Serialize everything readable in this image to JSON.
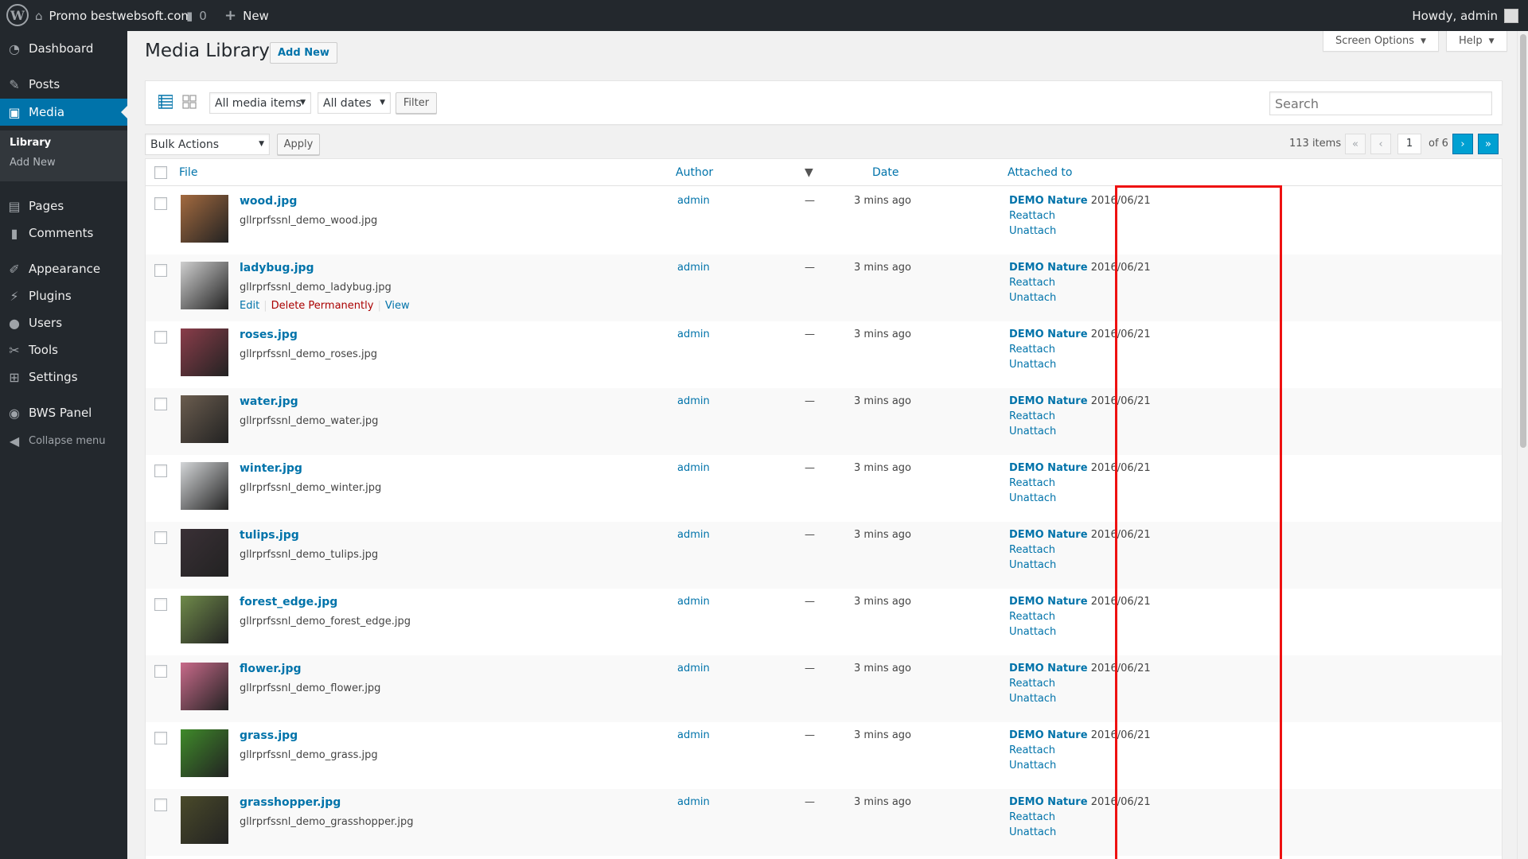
{
  "adminbar": {
    "site_name": "Promo bestwebsoft.com",
    "comments_count": "0",
    "new_label": "New",
    "howdy": "Howdy, admin"
  },
  "sidebar": {
    "items": [
      {
        "label": "Dashboard",
        "icon": "dashboard-icon"
      },
      {
        "label": "Posts",
        "icon": "pin-icon"
      },
      {
        "label": "Media",
        "icon": "media-icon"
      },
      {
        "label": "Pages",
        "icon": "pages-icon"
      },
      {
        "label": "Comments",
        "icon": "comments-icon"
      },
      {
        "label": "Appearance",
        "icon": "brush-icon"
      },
      {
        "label": "Plugins",
        "icon": "plugin-icon"
      },
      {
        "label": "Users",
        "icon": "users-icon"
      },
      {
        "label": "Tools",
        "icon": "wrench-icon"
      },
      {
        "label": "Settings",
        "icon": "settings-icon"
      },
      {
        "label": "BWS Panel",
        "icon": "bws-icon"
      }
    ],
    "submenu": [
      "Library",
      "Add New"
    ],
    "collapse": "Collapse menu"
  },
  "header": {
    "title": "Media Library",
    "add_new": "Add New",
    "screen_options": "Screen Options",
    "help": "Help"
  },
  "filters": {
    "media_type": "All media items",
    "dates": "All dates",
    "filter_btn": "Filter",
    "search_placeholder": "Search"
  },
  "tablenav": {
    "bulk_actions": "Bulk Actions",
    "apply": "Apply",
    "items_count": "113 items",
    "current_page": "1",
    "of_pages": "of 6",
    "first": "«",
    "prev": "‹",
    "next": "›",
    "last": "»"
  },
  "columns": {
    "file": "File",
    "author": "Author",
    "date": "Date",
    "attached_to": "Attached to"
  },
  "rows": [
    {
      "name": "wood.jpg",
      "path": "gllrprfssnl_demo_wood.jpg",
      "author": "admin",
      "comments": "—",
      "date": "3 mins ago",
      "parent": "DEMO Nature",
      "parent_date": "2016/06/21",
      "reattach": "Reattach",
      "unattach": "Unattach",
      "thumb": "#a36a3f"
    },
    {
      "name": "ladybug.jpg",
      "path": "gllrprfssnl_demo_ladybug.jpg",
      "author": "admin",
      "comments": "—",
      "date": "3 mins ago",
      "parent": "DEMO Nature",
      "parent_date": "2016/06/21",
      "reattach": "Reattach",
      "unattach": "Unattach",
      "thumb": "#cfcfcf",
      "actions": {
        "edit": "Edit",
        "delete": "Delete Permanently",
        "view": "View"
      }
    },
    {
      "name": "roses.jpg",
      "path": "gllrprfssnl_demo_roses.jpg",
      "author": "admin",
      "comments": "—",
      "date": "3 mins ago",
      "parent": "DEMO Nature",
      "parent_date": "2016/06/21",
      "reattach": "Reattach",
      "unattach": "Unattach",
      "thumb": "#8a3d4a"
    },
    {
      "name": "water.jpg",
      "path": "gllrprfssnl_demo_water.jpg",
      "author": "admin",
      "comments": "—",
      "date": "3 mins ago",
      "parent": "DEMO Nature",
      "parent_date": "2016/06/21",
      "reattach": "Reattach",
      "unattach": "Unattach",
      "thumb": "#6b5d4f"
    },
    {
      "name": "winter.jpg",
      "path": "gllrprfssnl_demo_winter.jpg",
      "author": "admin",
      "comments": "—",
      "date": "3 mins ago",
      "parent": "DEMO Nature",
      "parent_date": "2016/06/21",
      "reattach": "Reattach",
      "unattach": "Unattach",
      "thumb": "#d4d6d8"
    },
    {
      "name": "tulips.jpg",
      "path": "gllrprfssnl_demo_tulips.jpg",
      "author": "admin",
      "comments": "—",
      "date": "3 mins ago",
      "parent": "DEMO Nature",
      "parent_date": "2016/06/21",
      "reattach": "Reattach",
      "unattach": "Unattach",
      "thumb": "#3a3036"
    },
    {
      "name": "forest_edge.jpg",
      "path": "gllrprfssnl_demo_forest_edge.jpg",
      "author": "admin",
      "comments": "—",
      "date": "3 mins ago",
      "parent": "DEMO Nature",
      "parent_date": "2016/06/21",
      "reattach": "Reattach",
      "unattach": "Unattach",
      "thumb": "#6f8a4a"
    },
    {
      "name": "flower.jpg",
      "path": "gllrprfssnl_demo_flower.jpg",
      "author": "admin",
      "comments": "—",
      "date": "3 mins ago",
      "parent": "DEMO Nature",
      "parent_date": "2016/06/21",
      "reattach": "Reattach",
      "unattach": "Unattach",
      "thumb": "#c86a8a"
    },
    {
      "name": "grass.jpg",
      "path": "gllrprfssnl_demo_grass.jpg",
      "author": "admin",
      "comments": "—",
      "date": "3 mins ago",
      "parent": "DEMO Nature",
      "parent_date": "2016/06/21",
      "reattach": "Reattach",
      "unattach": "Unattach",
      "thumb": "#3f8a2a"
    },
    {
      "name": "grasshopper.jpg",
      "path": "gllrprfssnl_demo_grasshopper.jpg",
      "author": "admin",
      "comments": "—",
      "date": "3 mins ago",
      "parent": "DEMO Nature",
      "parent_date": "2016/06/21",
      "reattach": "Reattach",
      "unattach": "Unattach",
      "thumb": "#4a4a2a"
    }
  ],
  "colors": {
    "accent": "#0073aa",
    "adminbar": "#23282d",
    "highlight": "#ee1111"
  }
}
